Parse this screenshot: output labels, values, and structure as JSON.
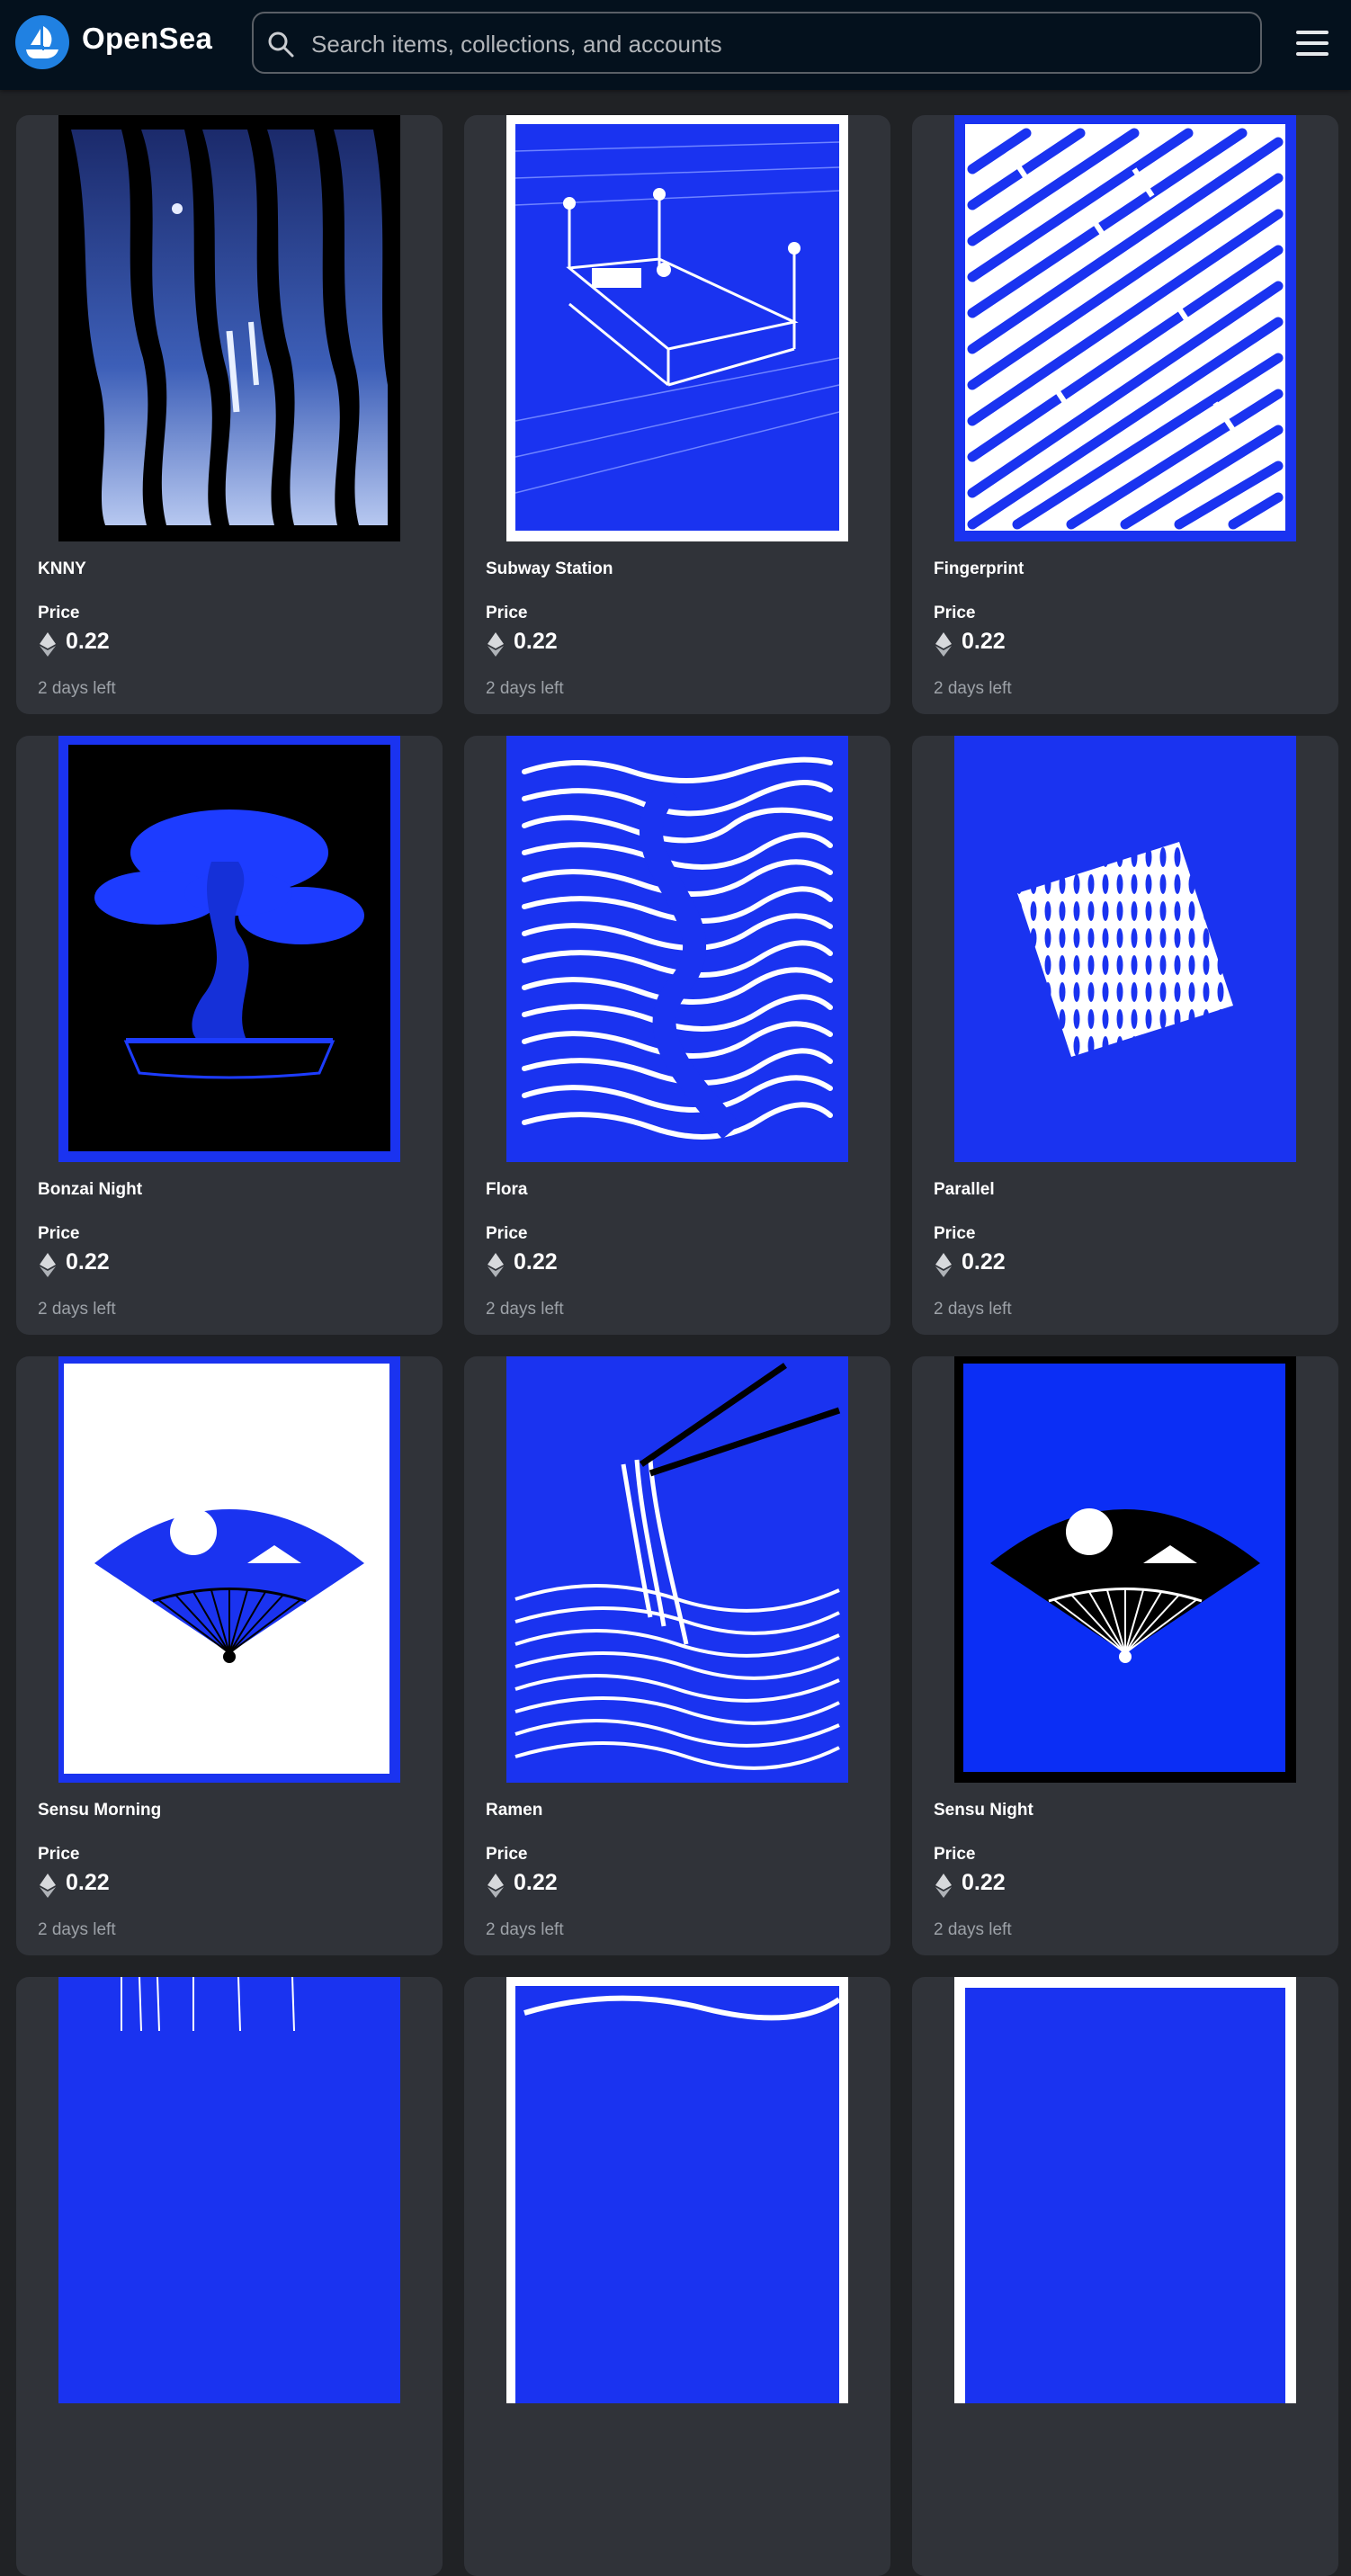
{
  "app": {
    "brand": "OpenSea",
    "accent_color": "#2081e2"
  },
  "search": {
    "placeholder": "Search items, collections, and accounts"
  },
  "icons": {
    "logo": "opensea-ship-logo",
    "search": "search-icon",
    "menu": "hamburger-menu-icon",
    "currency": "ethereum-icon"
  },
  "grid": {
    "price_label": "Price",
    "items": [
      {
        "name": "KNNY",
        "price": "0.22",
        "time_left": "2 days left"
      },
      {
        "name": "Subway Station",
        "price": "0.22",
        "time_left": "2 days left"
      },
      {
        "name": "Fingerprint",
        "price": "0.22",
        "time_left": "2 days left"
      },
      {
        "name": "Bonzai Night",
        "price": "0.22",
        "time_left": "2 days left"
      },
      {
        "name": "Flora",
        "price": "0.22",
        "time_left": "2 days left"
      },
      {
        "name": "Parallel",
        "price": "0.22",
        "time_left": "2 days left"
      },
      {
        "name": "Sensu Morning",
        "price": "0.22",
        "time_left": "2 days left"
      },
      {
        "name": "Ramen",
        "price": "0.22",
        "time_left": "2 days left"
      },
      {
        "name": "Sensu Night",
        "price": "0.22",
        "time_left": "2 days left"
      }
    ]
  }
}
